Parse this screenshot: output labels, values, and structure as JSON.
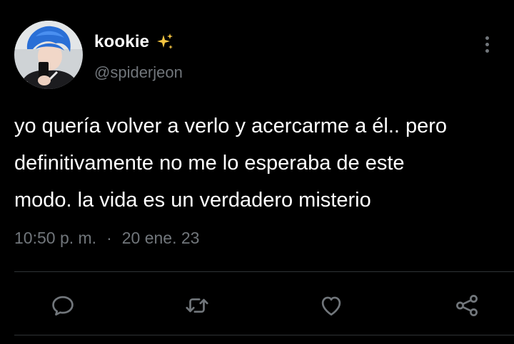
{
  "author": {
    "display_name": "kookie",
    "handle": "@spiderjeon",
    "name_emoji_icon": "sparkles-icon",
    "avatar_icon": "profile-photo"
  },
  "tweet": {
    "text": "yo quería volver a verlo y acercarme a él.. pero\ndefinitivamente no me lo esperaba de este\nmodo. la vida es un verdadero misterio",
    "time": "10:50 p. m.",
    "separator": "·",
    "date": "20 ene. 23"
  },
  "actions": [
    {
      "icon": "reply-icon"
    },
    {
      "icon": "retweet-icon"
    },
    {
      "icon": "like-icon"
    },
    {
      "icon": "share-icon"
    }
  ],
  "colors": {
    "background": "#000000",
    "text_primary": "#ffffff",
    "text_secondary": "#71767b",
    "divider": "#2f3336",
    "sparkle": "#f5c542",
    "avatar_hair": "#2a6fd6"
  }
}
